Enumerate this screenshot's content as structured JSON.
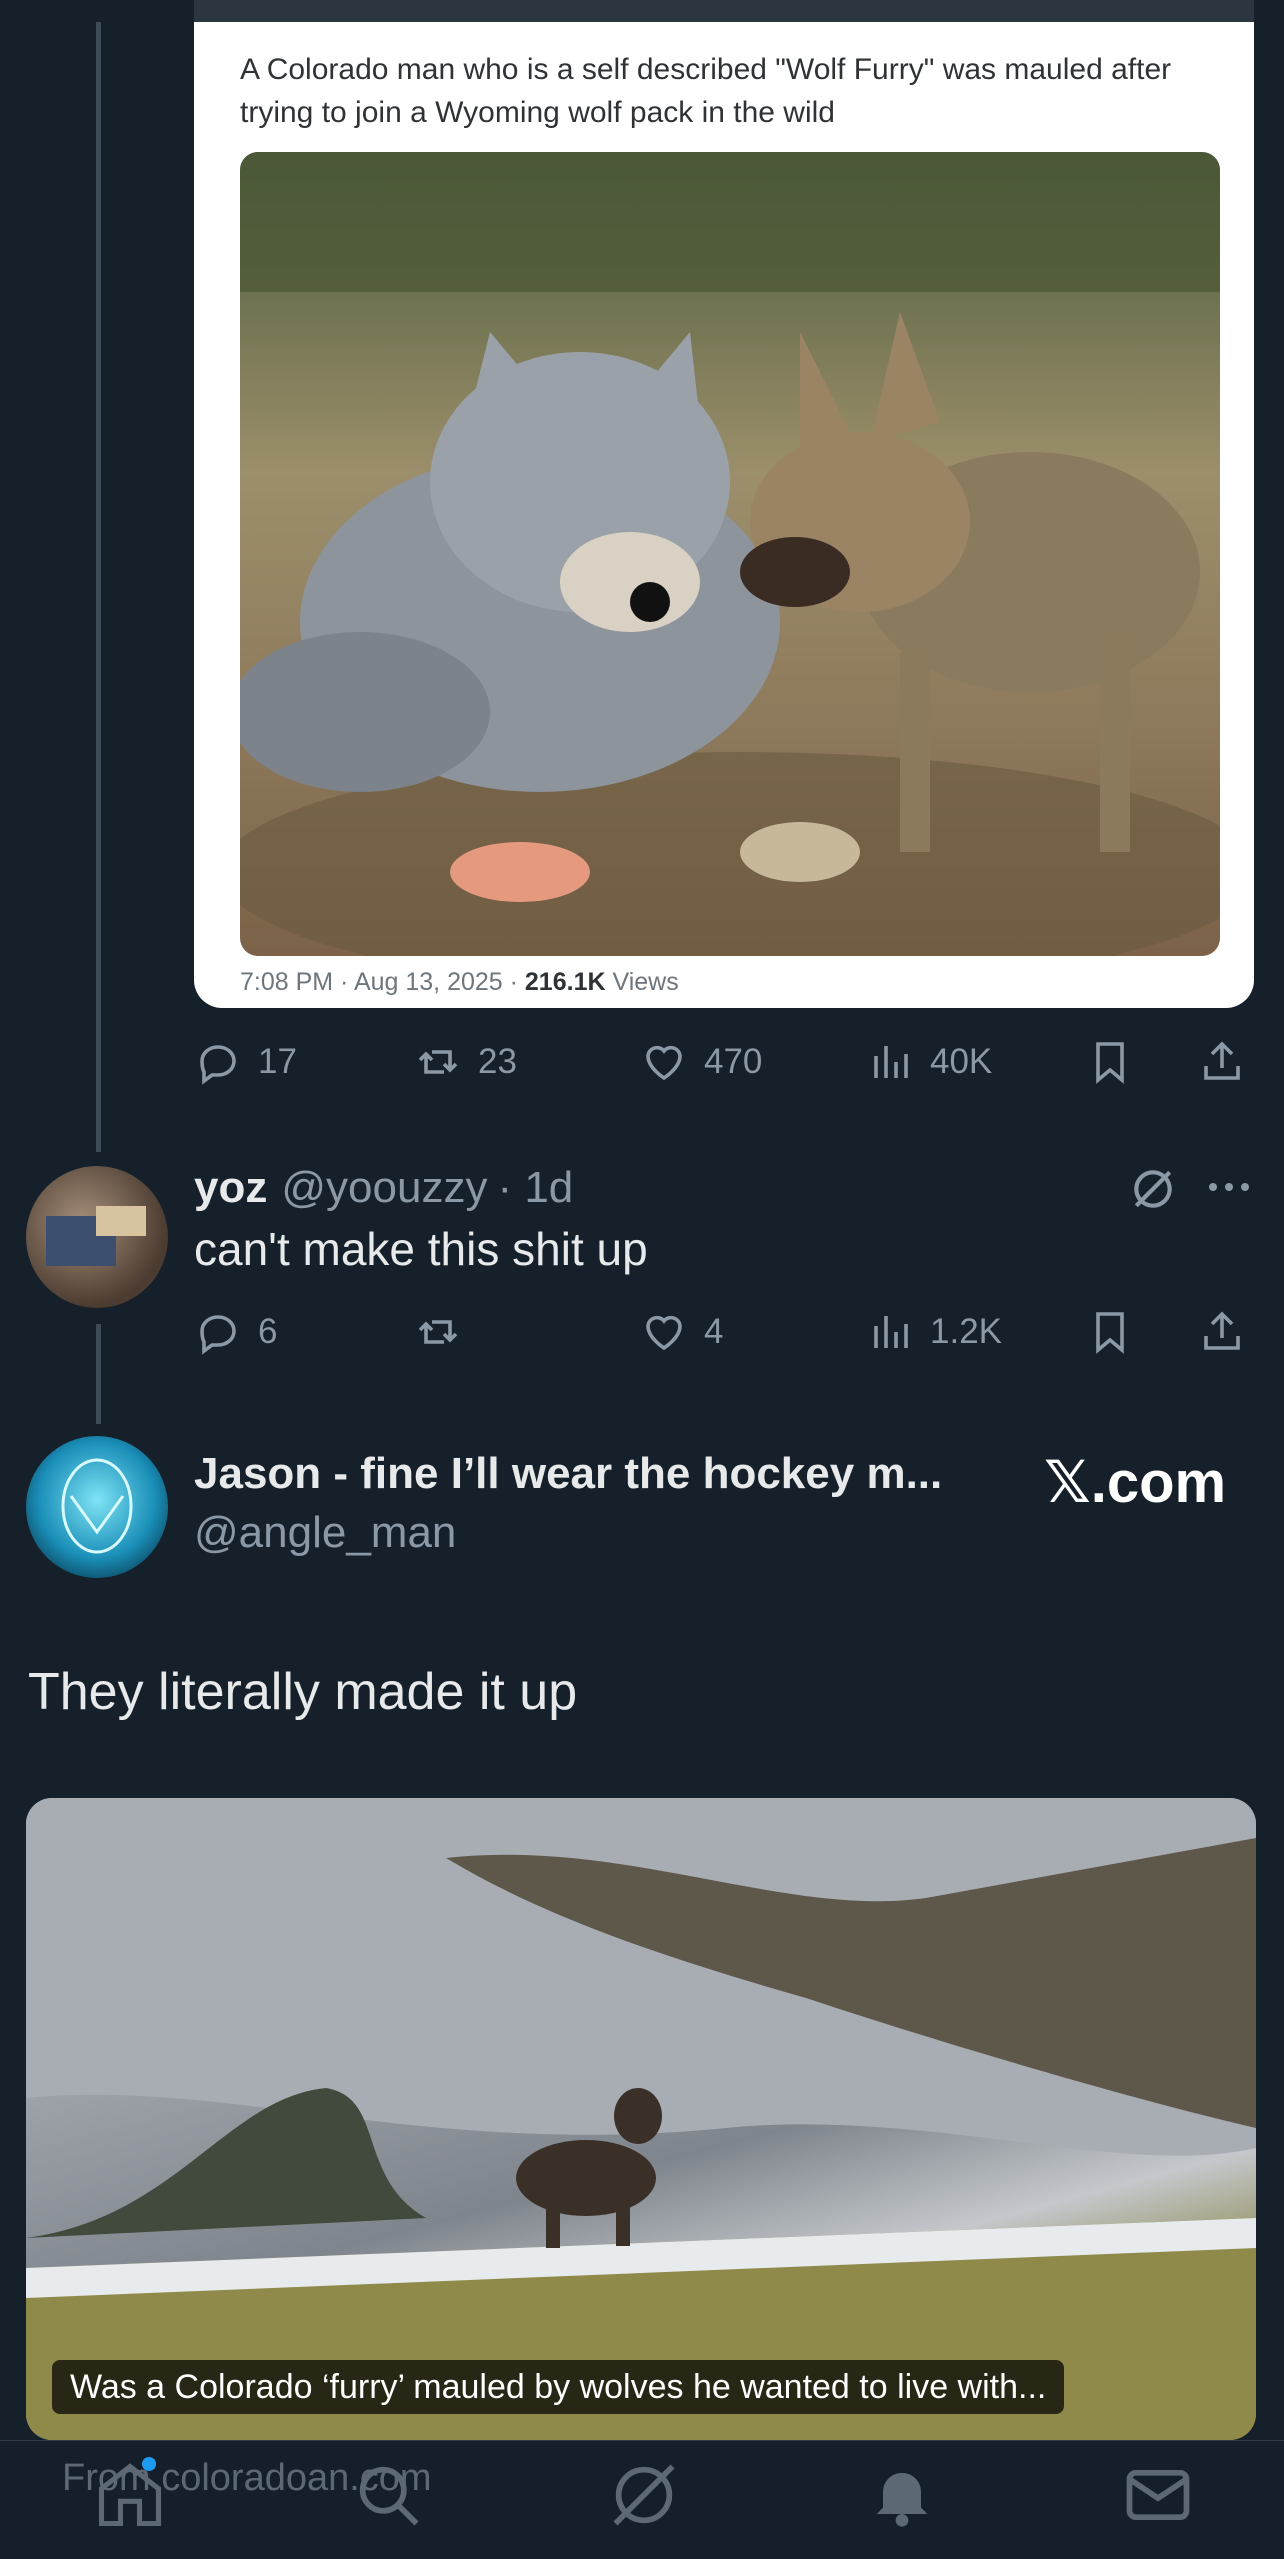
{
  "quoted_tweet": {
    "text": "A Colorado man who is a self described \"Wolf Furry\" was mauled after trying to join a Wyoming wolf pack in the wild",
    "time": "7:08 PM · Aug 13, 2025 · ",
    "views_count": "216.1K",
    "views_label": " Views",
    "image_icon": "image-wolf-furry-and-wolf"
  },
  "post1_actions": {
    "replies": "17",
    "reposts": "23",
    "likes": "470",
    "views": "40K"
  },
  "reply": {
    "name": "yoz",
    "handle": "@yoouzzy",
    "time": "· 1d",
    "text": "can't make this shit up",
    "actions": {
      "replies": "6",
      "reposts": "",
      "likes": "4",
      "views": "1.2K"
    }
  },
  "post2": {
    "name": "Jason - fine I’ll wear the hockey m...",
    "handle": "@angle_man",
    "badge": "𝕏.com",
    "text": "They literally made it up",
    "link_caption": "Was a Colorado ‘furry’ mauled by wolves he wanted to live with...",
    "link_source": "From coloradoan.com"
  },
  "tabbar": {
    "items": [
      "home-icon",
      "search-icon",
      "grok-icon",
      "notifications-icon",
      "messages-icon"
    ]
  },
  "colors": {
    "background": "#15202b",
    "text": "#e7e9ea",
    "secondary": "#8b98a5",
    "notification_dot": "#1d9bf0"
  }
}
